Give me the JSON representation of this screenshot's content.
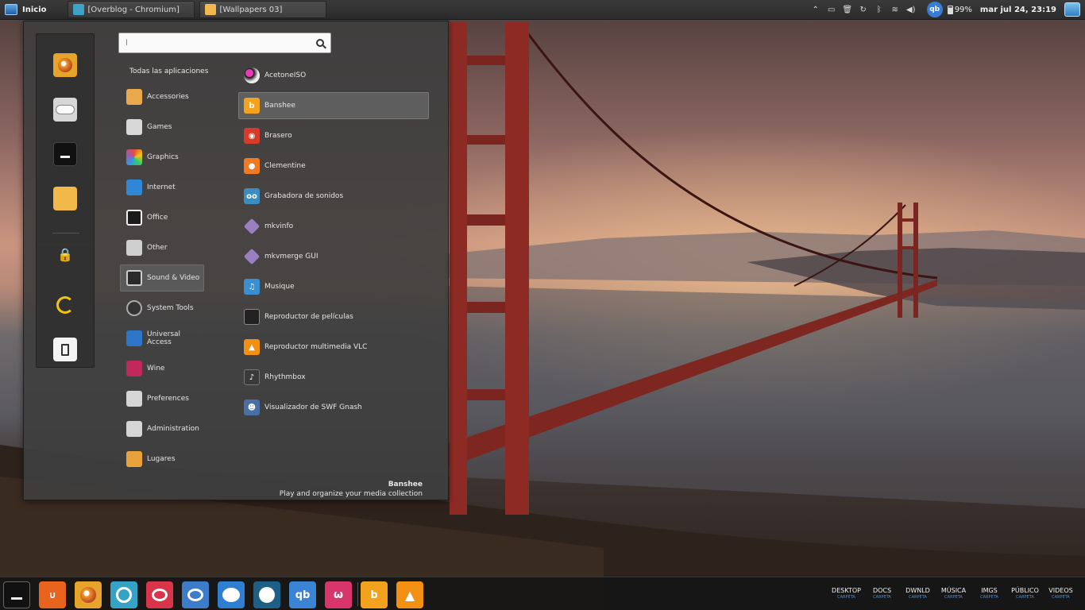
{
  "top_panel": {
    "start_label": "Inicio",
    "tasks": [
      "[Overblog - Chromium]",
      "[Wallpapers 03]"
    ],
    "battery": "99%",
    "clock": "mar jul 24, 23:19",
    "qb_label": "qb"
  },
  "menu": {
    "search": {
      "value": "",
      "placeholder": "l"
    },
    "categories_header": "Todas las aplicaciones",
    "categories": [
      "Accessories",
      "Games",
      "Graphics",
      "Internet",
      "Office",
      "Other",
      "Sound & Video",
      "System Tools",
      "Universal Access",
      "Wine",
      "Preferences",
      "Administration",
      "Lugares"
    ],
    "apps": [
      "AcetoneISO",
      "Banshee",
      "Brasero",
      "Clementine",
      "Grabadora de sonidos",
      "mkvinfo",
      "mkvmerge GUI",
      "Musique",
      "Reproductor de películas",
      "Reproductor multimedia VLC",
      "Rhythmbox",
      "Visualizador de SWF Gnash"
    ],
    "description": {
      "title": "Banshee",
      "text": "Play and organize your media collection"
    }
  },
  "dock": {
    "qb_label": "qb",
    "folders": [
      {
        "name": "DESKTOP",
        "sub": "CARPETA"
      },
      {
        "name": "DOCS",
        "sub": "CARPETA"
      },
      {
        "name": "DWNLD",
        "sub": "CARPETA"
      },
      {
        "name": "MÚSICA",
        "sub": "CARPETA"
      },
      {
        "name": "IMGS",
        "sub": "CARPETA"
      },
      {
        "name": "PÚBLICO",
        "sub": "CARPETA"
      },
      {
        "name": "VIDEOS",
        "sub": "CARPETA"
      }
    ]
  },
  "colors": {
    "accent_blue": "#3a7cd1",
    "menu_bg": "#3e3e3e",
    "bridge_red": "#8e2a24"
  }
}
